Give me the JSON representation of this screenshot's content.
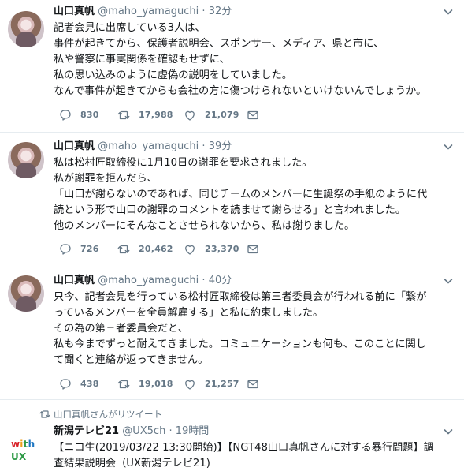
{
  "tweets": [
    {
      "name": "山口真帆",
      "handle": "@maho_yamaguchi",
      "dot": "·",
      "time": "32分",
      "lines": [
        "記者会見に出席している3人は、",
        "事件が起きてから、保護者説明会、スポンサー、メディア、県と市に、",
        "私や警察に事実関係を確認もせずに、",
        "私の思い込みのように虚偽の説明をしていました。",
        "なんで事件が起きてからも会社の方に傷つけられないといけないんでしょうか。"
      ],
      "reply_count": "830",
      "retweet_count": "17,988",
      "like_count": "21,079"
    },
    {
      "name": "山口真帆",
      "handle": "@maho_yamaguchi",
      "dot": "·",
      "time": "39分",
      "lines": [
        "私は松村匠取締役に1月10日の謝罪を要求されました。",
        "私が謝罪を拒んだら、",
        "「山口が謝らないのであれば、同じチームのメンバーに生誕祭の手紙のように代",
        "読という形で山口の謝罪のコメントを読ませて謝らせる」と言われました。",
        "他のメンバーにそんなことさせられないから、私は謝りました。"
      ],
      "reply_count": "726",
      "retweet_count": "20,462",
      "like_count": "23,370"
    },
    {
      "name": "山口真帆",
      "handle": "@maho_yamaguchi",
      "dot": "·",
      "time": "40分",
      "lines": [
        "只今、記者会見を行っている松村匠取締役は第三者委員会が行われる前に「繋が",
        "っているメンバーを全員解雇する」と私に約束しました。",
        "その為の第三者委員会だと、",
        "私も今までずっと耐えてきました。コミュニケーションも何も、このことに関し",
        "て聞くと連絡が返ってきません。"
      ],
      "reply_count": "438",
      "retweet_count": "19,018",
      "like_count": "21,257"
    }
  ],
  "retweet": {
    "label": "山口真帆さんがリツイート",
    "name": "新潟テレビ21",
    "handle": "@UX5ch",
    "dot": "·",
    "time": "19時間",
    "logo_text": "UX",
    "lines": [
      "【ニコ生(2019/03/22 13:30開始)】【NGT48山口真帆さんに対する暴行問題】調",
      "査結果説明会（UX新潟テレビ21)"
    ]
  },
  "icons": {
    "reply": "reply-icon",
    "retweet": "retweet-icon",
    "like": "heart-icon",
    "dm": "envelope-icon",
    "more": "chevron-down-icon"
  },
  "colors": {
    "text": "#14171a",
    "muted": "#657786",
    "divider": "#e6ecf0"
  }
}
